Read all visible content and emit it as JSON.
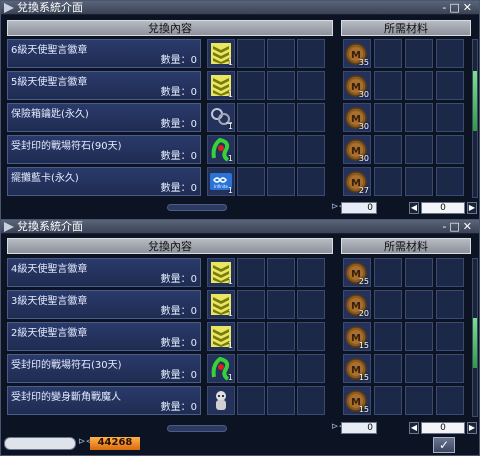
{
  "top_window": {
    "title": "兌換系統介面",
    "title_buttons": "-□✕",
    "col_left": "兌換內容",
    "col_right": "所需材料",
    "items": [
      {
        "name": "6級天使聖言徽章",
        "qty": "數量：0",
        "icon": "chevron-badge-icon",
        "reward_count": "1",
        "cost_count": "35",
        "cost_icon": "medal-coin-icon"
      },
      {
        "name": "5級天使聖言徽章",
        "qty": "數量：0",
        "icon": "chevron-badge-icon",
        "reward_count": "1",
        "cost_count": "30",
        "cost_icon": "medal-coin-icon"
      },
      {
        "name": "保險箱鑰匙(永久)",
        "qty": "數量：0",
        "icon": "key-ring-icon",
        "reward_count": "1",
        "cost_count": "30",
        "cost_icon": "medal-coin-icon"
      },
      {
        "name": "受封印的戰場符石(90天)",
        "qty": "數量：0",
        "icon": "green-rune-icon",
        "reward_count": "1",
        "cost_count": "30",
        "cost_icon": "medal-coin-icon"
      },
      {
        "name": "擺攤藍卡(永久)",
        "qty": "數量：0",
        "icon": "blue-card-icon",
        "reward_count": "1",
        "cost_count": "27",
        "cost_icon": "medal-coin-icon"
      }
    ],
    "footer_value": "0",
    "footer_zero": "0",
    "scroll_level": 0.32
  },
  "bottom_window": {
    "title": "兌換系統介面",
    "title_buttons": "-□✕",
    "col_left": "兌換內容",
    "col_right": "所需材料",
    "items": [
      {
        "name": "4級天使聖言徽章",
        "qty": "數量：0",
        "icon": "chevron-badge-icon",
        "reward_count": "1",
        "cost_count": "25",
        "cost_icon": "medal-coin-icon"
      },
      {
        "name": "3級天使聖言徽章",
        "qty": "數量：0",
        "icon": "chevron-badge-icon",
        "reward_count": "1",
        "cost_count": "20",
        "cost_icon": "medal-coin-icon"
      },
      {
        "name": "2級天使聖言徽章",
        "qty": "數量：0",
        "icon": "chevron-badge-icon",
        "reward_count": "1",
        "cost_count": "15",
        "cost_icon": "medal-coin-icon"
      },
      {
        "name": "受封印的戰場符石(30天)",
        "qty": "數量：0",
        "icon": "green-rune-icon",
        "reward_count": "1",
        "cost_count": "15",
        "cost_icon": "medal-coin-icon"
      },
      {
        "name": "受封印的變身斷角戰魔人",
        "qty": "數量：0",
        "icon": "demon-figure-icon",
        "reward_count": "",
        "cost_count": "15",
        "cost_icon": "medal-coin-icon"
      }
    ],
    "footer_value": "0",
    "footer_zero": "0",
    "gold": "44268",
    "confirm": "✓",
    "scroll_level": 0.55
  },
  "colors": {
    "accent_green": "#3fbf4c",
    "gold": "#e88a20",
    "row_blue": "#2a3a6a"
  }
}
